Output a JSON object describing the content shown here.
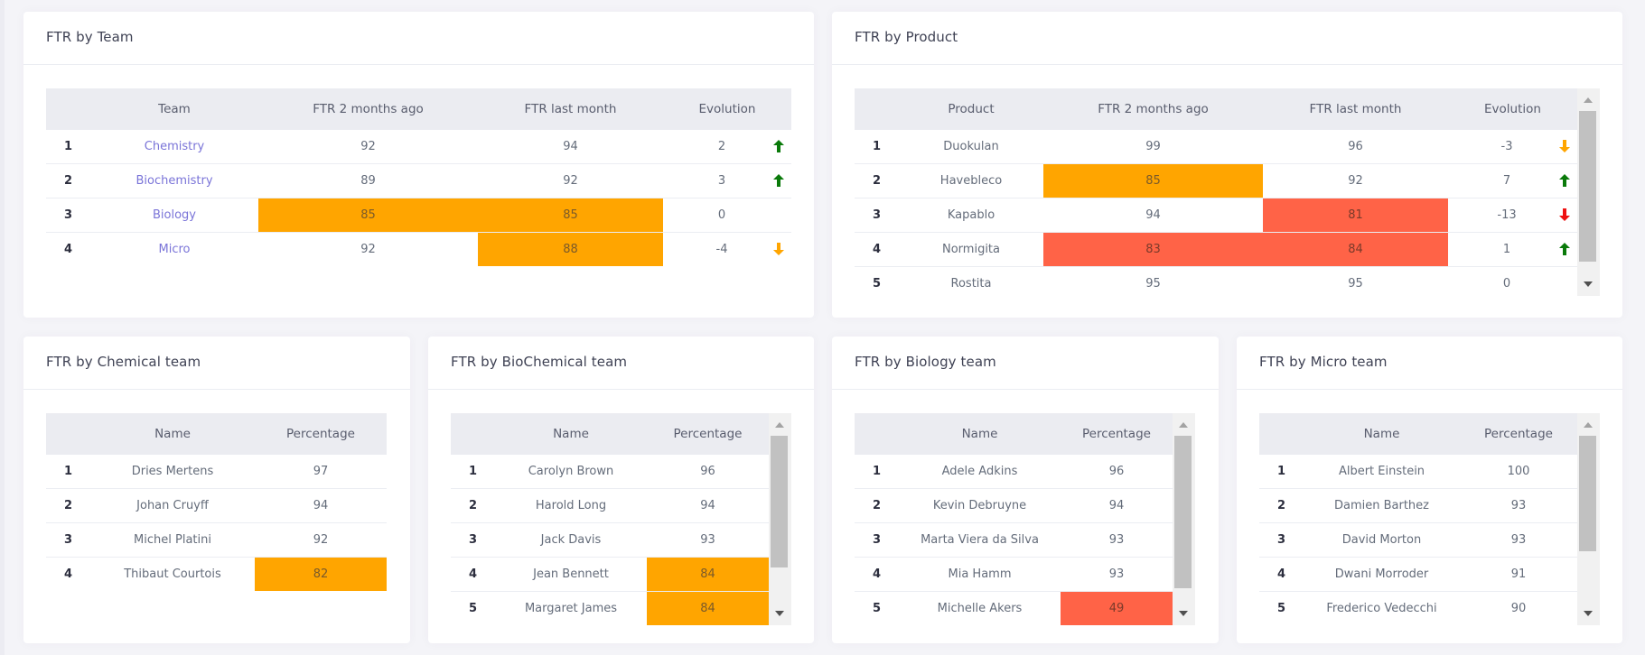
{
  "colors": {
    "link": "#7a74d8",
    "warning_highlight": "#ffa500",
    "danger_highlight": "#ff6347",
    "arrow_up": "#0a7a0a",
    "arrow_down_warning": "#ffa500",
    "arrow_down_danger": "#ee1111"
  },
  "team_card": {
    "title": "FTR by Team",
    "columns": [
      "",
      "Team",
      "FTR 2 months ago",
      "FTR last month",
      "Evolution"
    ],
    "rows": [
      {
        "rank": "1",
        "team": "Chemistry",
        "ftr_2m": "92",
        "ftr_last": "94",
        "evolution": "2",
        "trend": "up",
        "hl_2m": "",
        "hl_last": ""
      },
      {
        "rank": "2",
        "team": "Biochemistry",
        "ftr_2m": "89",
        "ftr_last": "92",
        "evolution": "3",
        "trend": "up",
        "hl_2m": "",
        "hl_last": ""
      },
      {
        "rank": "3",
        "team": "Biology",
        "ftr_2m": "85",
        "ftr_last": "85",
        "evolution": "0",
        "trend": "none",
        "hl_2m": "orange",
        "hl_last": "orange"
      },
      {
        "rank": "4",
        "team": "Micro",
        "ftr_2m": "92",
        "ftr_last": "88",
        "evolution": "-4",
        "trend": "down-warning",
        "hl_2m": "",
        "hl_last": "orange"
      }
    ]
  },
  "product_card": {
    "title": "FTR by Product",
    "columns": [
      "",
      "Product",
      "FTR 2 months ago",
      "FTR last month",
      "Evolution"
    ],
    "rows": [
      {
        "rank": "1",
        "product": "Duokulan",
        "ftr_2m": "99",
        "ftr_last": "96",
        "evolution": "-3",
        "trend": "down-warning",
        "hl_2m": "",
        "hl_last": ""
      },
      {
        "rank": "2",
        "product": "Havebleco",
        "ftr_2m": "85",
        "ftr_last": "92",
        "evolution": "7",
        "trend": "up",
        "hl_2m": "orange",
        "hl_last": ""
      },
      {
        "rank": "3",
        "product": "Kapablo",
        "ftr_2m": "94",
        "ftr_last": "81",
        "evolution": "-13",
        "trend": "down-danger",
        "hl_2m": "",
        "hl_last": "red"
      },
      {
        "rank": "4",
        "product": "Normigita",
        "ftr_2m": "83",
        "ftr_last": "84",
        "evolution": "1",
        "trend": "up",
        "hl_2m": "red",
        "hl_last": "red"
      },
      {
        "rank": "5",
        "product": "Rostita",
        "ftr_2m": "95",
        "ftr_last": "95",
        "evolution": "0",
        "trend": "none",
        "hl_2m": "",
        "hl_last": ""
      }
    ]
  },
  "member_cards": [
    {
      "title": "FTR by Chemical team",
      "columns": [
        "",
        "Name",
        "Percentage"
      ],
      "rows": [
        {
          "rank": "1",
          "name": "Dries Mertens",
          "pct": "97",
          "hl": ""
        },
        {
          "rank": "2",
          "name": "Johan Cruyff",
          "pct": "94",
          "hl": ""
        },
        {
          "rank": "3",
          "name": "Michel Platini",
          "pct": "92",
          "hl": ""
        },
        {
          "rank": "4",
          "name": "Thibaut Courtois",
          "pct": "82",
          "hl": "orange"
        }
      ]
    },
    {
      "title": "FTR by BioChemical team",
      "columns": [
        "",
        "Name",
        "Percentage"
      ],
      "rows": [
        {
          "rank": "1",
          "name": "Carolyn Brown",
          "pct": "96",
          "hl": ""
        },
        {
          "rank": "2",
          "name": "Harold Long",
          "pct": "94",
          "hl": ""
        },
        {
          "rank": "3",
          "name": "Jack Davis",
          "pct": "93",
          "hl": ""
        },
        {
          "rank": "4",
          "name": "Jean Bennett",
          "pct": "84",
          "hl": "orange"
        },
        {
          "rank": "5",
          "name": "Margaret James",
          "pct": "84",
          "hl": "orange"
        }
      ]
    },
    {
      "title": "FTR by Biology team",
      "columns": [
        "",
        "Name",
        "Percentage"
      ],
      "rows": [
        {
          "rank": "1",
          "name": "Adele Adkins",
          "pct": "96",
          "hl": ""
        },
        {
          "rank": "2",
          "name": "Kevin Debruyne",
          "pct": "94",
          "hl": ""
        },
        {
          "rank": "3",
          "name": "Marta Viera da Silva",
          "pct": "93",
          "hl": ""
        },
        {
          "rank": "4",
          "name": "Mia Hamm",
          "pct": "93",
          "hl": ""
        },
        {
          "rank": "5",
          "name": "Michelle Akers",
          "pct": "49",
          "hl": "red"
        }
      ]
    },
    {
      "title": "FTR by Micro team",
      "columns": [
        "",
        "Name",
        "Percentage"
      ],
      "rows": [
        {
          "rank": "1",
          "name": "Albert Einstein",
          "pct": "100",
          "hl": ""
        },
        {
          "rank": "2",
          "name": "Damien Barthez",
          "pct": "93",
          "hl": ""
        },
        {
          "rank": "3",
          "name": "David Morton",
          "pct": "93",
          "hl": ""
        },
        {
          "rank": "4",
          "name": "Dwani Morroder",
          "pct": "91",
          "hl": ""
        },
        {
          "rank": "5",
          "name": "Frederico Vedecchi",
          "pct": "90",
          "hl": ""
        }
      ]
    }
  ]
}
